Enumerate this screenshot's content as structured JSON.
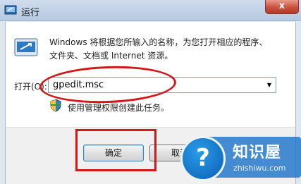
{
  "window": {
    "title": "运行",
    "close_glyph": "x"
  },
  "dialog": {
    "description_line1": "Windows 将根据您所输入的名称，为您打开相应的程序、",
    "description_line2": "文件夹、文档或 Internet 资源。",
    "open_label": "打开(O):",
    "command_value": "gpedit.msc",
    "admin_note": "使用管理权限创建此任务。",
    "ok_label": "确定",
    "cancel_label": "取消"
  },
  "annotations": {
    "highlight_color": "#d41818"
  },
  "watermark": {
    "badge_glyph": "?",
    "title": "知识屋",
    "url": "zhishiwu.com"
  }
}
